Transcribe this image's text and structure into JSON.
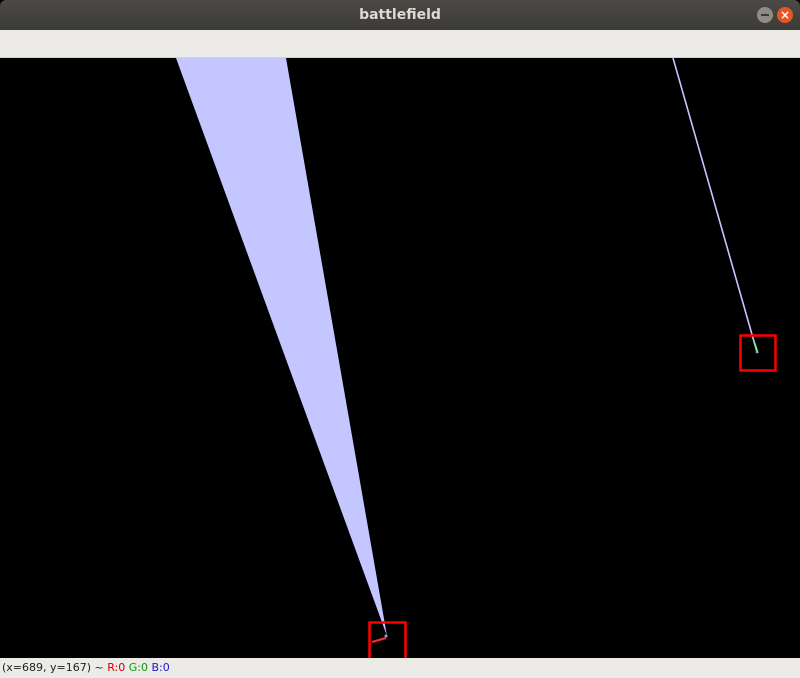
{
  "window": {
    "title": "battlefield",
    "close_glyph": "×"
  },
  "icons": {
    "minimize": "minimize-icon",
    "close": "close-icon"
  },
  "canvas": {
    "background": "#000000",
    "beam_color": "#c4c6ff",
    "target_box_color": "#ff0000"
  },
  "status": {
    "coords": "(x=689, y=167) ~",
    "r": "R:0",
    "g": "G:0",
    "b": "B:0",
    "r_color": "#d00000",
    "g_color": "#0a9a0a",
    "b_color": "#1a1acc"
  }
}
